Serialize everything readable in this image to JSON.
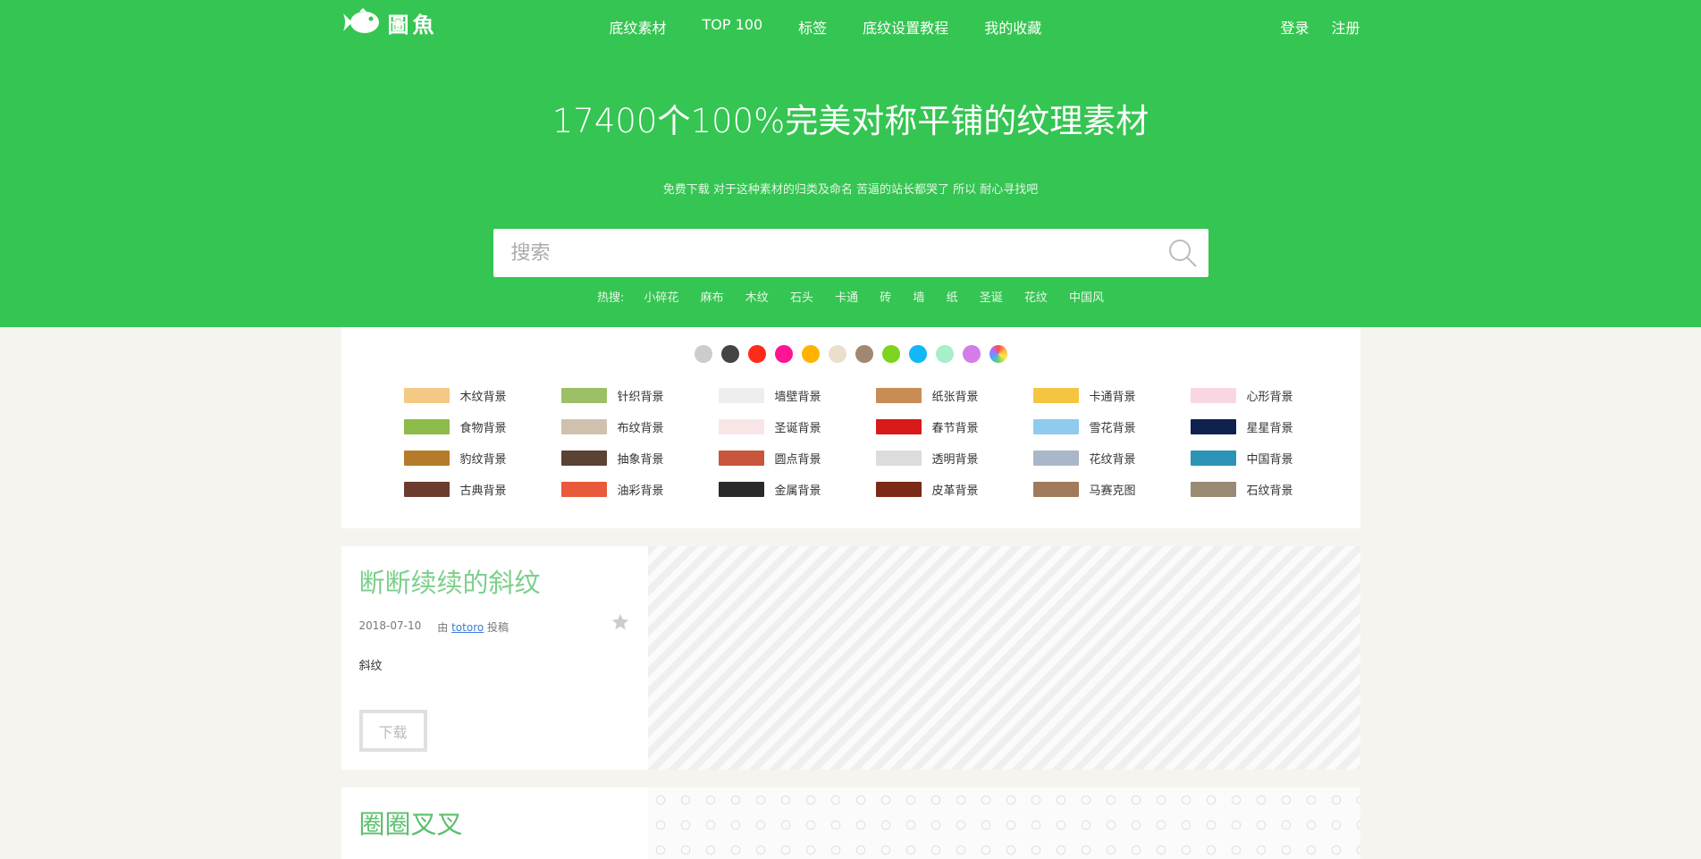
{
  "nav": {
    "logo_text": "圖魚",
    "links": [
      "底纹素材",
      "TOP 100",
      "标签",
      "底纹设置教程",
      "我的收藏"
    ],
    "login": "登录",
    "register": "注册"
  },
  "hero": {
    "headline": "17400个100%完美对称平铺的纹理素材",
    "subline": "免费下载 对于这种素材的归类及命名 苦逼的站长都哭了 所以 耐心寻找吧",
    "search_placeholder": "搜索",
    "hot_label": "热搜:",
    "hot_terms": [
      "小碎花",
      "麻布",
      "木纹",
      "石头",
      "卡通",
      "砖",
      "墙",
      "纸",
      "圣诞",
      "花纹",
      "中国风"
    ]
  },
  "colors": [
    "#cccccc",
    "#444444",
    "#ff2a1a",
    "#ff1493",
    "#ffb300",
    "#e9dfcc",
    "#a08872",
    "#7ed321",
    "#10b8f5",
    "#a6efc8",
    "#d47ce8",
    "rainbow"
  ],
  "categories": [
    {
      "label": "木纹背景",
      "color": "#f3c985"
    },
    {
      "label": "针织背景",
      "color": "#9cc066"
    },
    {
      "label": "墙壁背景",
      "color": "#eeeeee"
    },
    {
      "label": "纸张背景",
      "color": "#c98c55"
    },
    {
      "label": "卡通背景",
      "color": "#f5c542"
    },
    {
      "label": "心形背景",
      "color": "#f8d7e2"
    },
    {
      "label": "食物背景",
      "color": "#8dbb4a"
    },
    {
      "label": "布纹背景",
      "color": "#cfc1ae"
    },
    {
      "label": "圣诞背景",
      "color": "#f9e5e5"
    },
    {
      "label": "春节背景",
      "color": "#d71a1a"
    },
    {
      "label": "雪花背景",
      "color": "#8fcbef"
    },
    {
      "label": "星星背景",
      "color": "#10204f"
    },
    {
      "label": "豹纹背景",
      "color": "#b57a2a"
    },
    {
      "label": "抽象背景",
      "color": "#5b4233"
    },
    {
      "label": "圆点背景",
      "color": "#c9553d"
    },
    {
      "label": "透明背景",
      "color": "#dcdcdc"
    },
    {
      "label": "花纹背景",
      "color": "#a9b7c8"
    },
    {
      "label": "中国背景",
      "color": "#2b93b6"
    },
    {
      "label": "古典背景",
      "color": "#6b3b2e"
    },
    {
      "label": "油彩背景",
      "color": "#e85a3a"
    },
    {
      "label": "金属背景",
      "color": "#2a2a2a"
    },
    {
      "label": "皮革背景",
      "color": "#7a2a16"
    },
    {
      "label": "马赛克图",
      "color": "#a07a5a"
    },
    {
      "label": "石纹背景",
      "color": "#9a8a74"
    }
  ],
  "cards": [
    {
      "title": "断断续续的斜纹",
      "date": "2018-07-10",
      "by": "由",
      "author": "totoro",
      "submitted": "投稿",
      "desc": "斜纹",
      "download": "下载"
    },
    {
      "title": "圈圈叉叉"
    }
  ]
}
